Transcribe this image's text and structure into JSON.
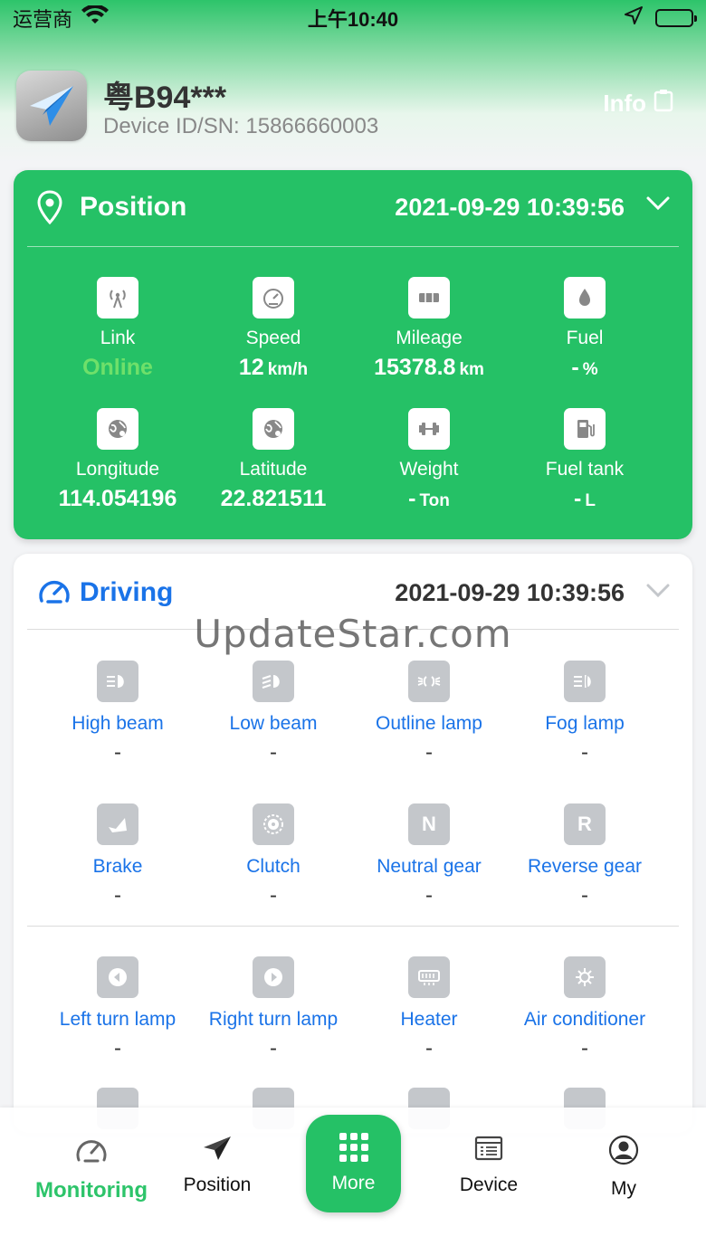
{
  "status_bar": {
    "carrier": "运营商",
    "time": "上午10:40"
  },
  "header": {
    "plate": "粤B94***",
    "device_id": "Device ID/SN: 15866660003",
    "info_label": "Info"
  },
  "position_card": {
    "title": "Position",
    "timestamp": "2021-09-29 10:39:56",
    "items": [
      {
        "label": "Link",
        "value": "Online",
        "unit": "",
        "icon": "antenna-icon"
      },
      {
        "label": "Speed",
        "value": "12",
        "unit": "km/h",
        "icon": "speedometer-icon"
      },
      {
        "label": "Mileage",
        "value": "15378.8",
        "unit": "km",
        "icon": "odometer-icon"
      },
      {
        "label": "Fuel",
        "value": "-",
        "unit": "%",
        "icon": "fuel-drop-icon"
      },
      {
        "label": "Longitude",
        "value": "114.054196",
        "unit": "",
        "icon": "globe-icon"
      },
      {
        "label": "Latitude",
        "value": "22.821511",
        "unit": "",
        "icon": "globe-icon"
      },
      {
        "label": "Weight",
        "value": "-",
        "unit": "Ton",
        "icon": "weight-icon"
      },
      {
        "label": "Fuel tank",
        "value": "-",
        "unit": "L",
        "icon": "fuel-pump-icon"
      }
    ]
  },
  "driving_card": {
    "title": "Driving",
    "timestamp": "2021-09-29 10:39:56",
    "items": [
      {
        "label": "High beam",
        "value": "-",
        "icon": "high-beam-icon"
      },
      {
        "label": "Low beam",
        "value": "-",
        "icon": "low-beam-icon"
      },
      {
        "label": "Outline lamp",
        "value": "-",
        "icon": "outline-lamp-icon"
      },
      {
        "label": "Fog lamp",
        "value": "-",
        "icon": "fog-lamp-icon"
      },
      {
        "label": "Brake",
        "value": "-",
        "icon": "brake-icon"
      },
      {
        "label": "Clutch",
        "value": "-",
        "icon": "clutch-icon"
      },
      {
        "label": "Neutral gear",
        "value": "-",
        "icon": "neutral-gear-icon",
        "glyph": "N"
      },
      {
        "label": "Reverse gear",
        "value": "-",
        "icon": "reverse-gear-icon",
        "glyph": "R"
      },
      {
        "label": "Left turn lamp",
        "value": "-",
        "icon": "left-turn-icon"
      },
      {
        "label": "Right turn lamp",
        "value": "-",
        "icon": "right-turn-icon"
      },
      {
        "label": "Heater",
        "value": "-",
        "icon": "heater-icon"
      },
      {
        "label": "Air conditioner",
        "value": "-",
        "icon": "air-conditioner-icon"
      }
    ]
  },
  "watermark": "UpdateStar.com",
  "bottom_nav": {
    "items": [
      {
        "label": "Monitoring",
        "icon": "gauge-icon"
      },
      {
        "label": "Position",
        "icon": "paper-plane-icon"
      },
      {
        "label": "More",
        "icon": "grid-icon"
      },
      {
        "label": "Device",
        "icon": "device-list-icon"
      },
      {
        "label": "My",
        "icon": "user-icon"
      }
    ]
  },
  "colors": {
    "brand_green": "#25c166",
    "link_blue": "#1a73e8",
    "online_green": "#6fe06a"
  }
}
